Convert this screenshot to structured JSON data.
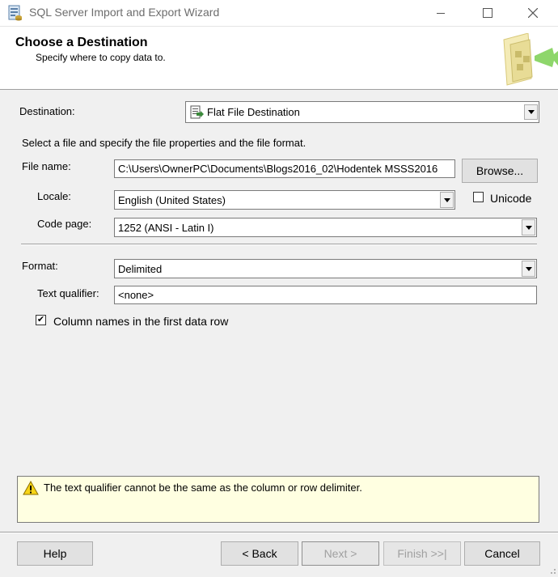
{
  "window": {
    "title": "SQL Server Import and Export Wizard",
    "controls": [
      "minimize-icon",
      "maximize-icon",
      "close-icon"
    ]
  },
  "header": {
    "title": "Choose a Destination",
    "subtitle": "Specify where to copy data to."
  },
  "destination": {
    "label": "Destination:",
    "value": "Flat File Destination"
  },
  "instruction": "Select a file and specify the file properties and the file format.",
  "file_name": {
    "label": "File name:",
    "value": "C:\\Users\\OwnerPC\\Documents\\Blogs2016_02\\Hodentek MSSS2016",
    "browse_label": "Browse..."
  },
  "locale": {
    "label": "Locale:",
    "value": "English (United States)",
    "unicode_label": "Unicode",
    "unicode_checked": false
  },
  "code_page": {
    "label": "Code page:",
    "value": "1252  (ANSI - Latin I)"
  },
  "format": {
    "label": "Format:",
    "value": "Delimited"
  },
  "text_qualifier": {
    "label": "Text qualifier:",
    "value": "<none>"
  },
  "column_names": {
    "label": "Column names in the first data row",
    "checked": true,
    "check_mark": "✔"
  },
  "message": {
    "icon": "warning-icon",
    "text": "The text qualifier cannot be the same as the column or row delimiter."
  },
  "footer": {
    "help": "Help",
    "back": "< Back",
    "next": "Next >",
    "finish": "Finish >>|",
    "cancel": "Cancel"
  }
}
